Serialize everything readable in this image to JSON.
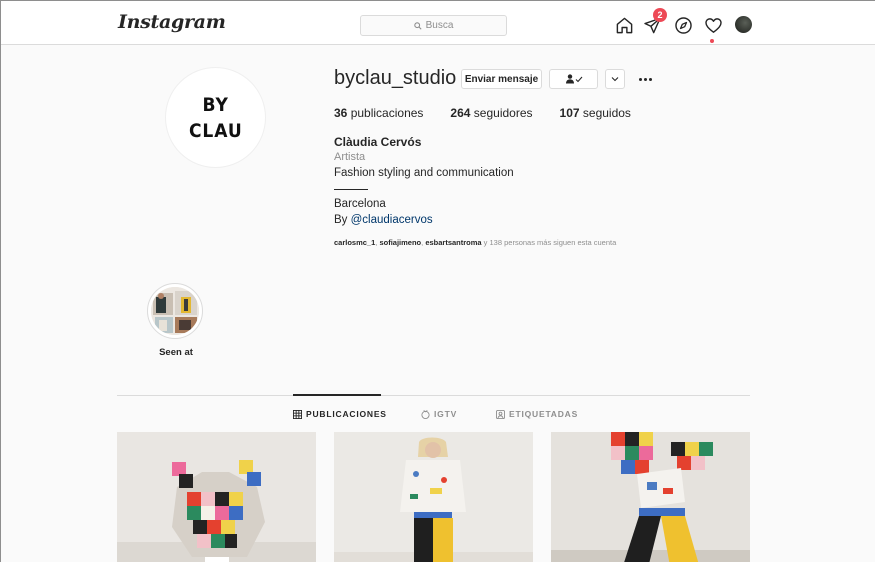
{
  "header": {
    "logo": "Instagram",
    "search": {
      "placeholder": "Busca"
    },
    "nav_icons": [
      "home-icon",
      "direct-icon",
      "explore-icon",
      "activity-heart-icon",
      "profile-avatar"
    ],
    "direct_badge": "2",
    "accent": "#ed4956"
  },
  "profile": {
    "avatar_text": [
      "BY",
      "CLAU"
    ],
    "username": "byclau_studio",
    "message_button": "Enviar mensaje",
    "stats": [
      {
        "count": "36",
        "label": "publicaciones"
      },
      {
        "count": "264",
        "label": "seguidores"
      },
      {
        "count": "107",
        "label": "seguidos"
      }
    ],
    "full_name": "Clàudia Cervós",
    "category": "Artista",
    "bio": "Fashion styling and communication",
    "city": "Barcelona",
    "by_prefix": "By",
    "by_handle": "@claudiacervos",
    "followed_by": {
      "names": [
        "carlosmc_1",
        "sofiajimeno",
        "esbartsantroma"
      ],
      "separator": ", ",
      "suffix": " y 138 personas más siguen esta cuenta"
    }
  },
  "highlights": [
    {
      "label": "Seen at"
    }
  ],
  "tabs": [
    {
      "label": "PUBLICACIONES",
      "icon": "grid-icon",
      "active": true
    },
    {
      "label": "IGTV",
      "icon": "igtv-icon",
      "active": false
    },
    {
      "label": "ETIQUETADAS",
      "icon": "tagged-icon",
      "active": false
    }
  ],
  "colors": {
    "link": "#00376b",
    "text": "#262626",
    "muted": "#8e8e8e",
    "border": "#dbdbdb",
    "background": "#fafafa"
  }
}
